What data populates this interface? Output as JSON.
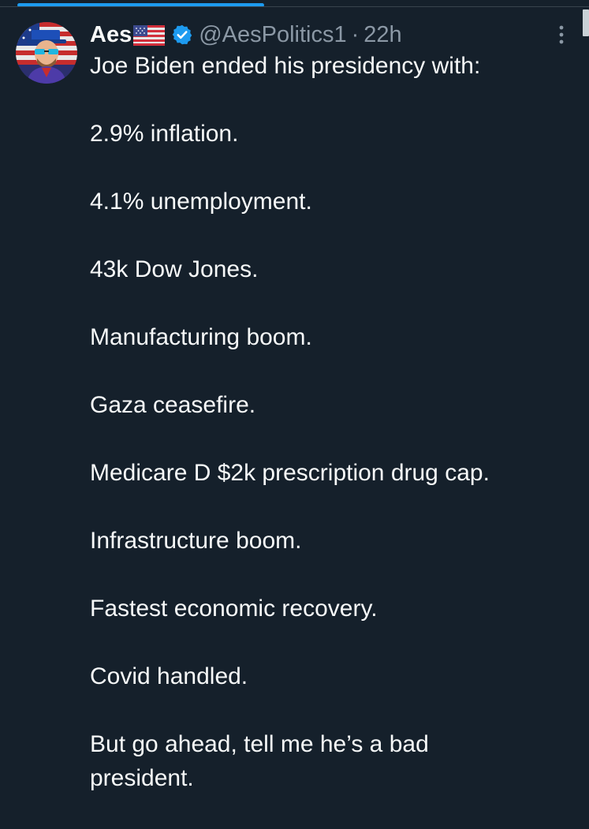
{
  "tweet": {
    "display_name": "Aes",
    "handle": "@AesPolitics1",
    "separator": "·",
    "time": "22h",
    "lines": [
      "Joe Biden ended his presidency with:",
      "2.9% inflation.",
      "4.1% unemployment.",
      "43k Dow Jones.",
      "Manufacturing boom.",
      "Gaza ceasefire.",
      "Medicare D $2k prescription drug cap.",
      "Infrastructure boom.",
      "Fastest economic recovery.",
      "Covid handled.",
      "But go ahead, tell me he’s a bad president."
    ]
  },
  "icons": {
    "flag": "us-flag-emoji",
    "verified": "verified-badge-icon",
    "more": "more-options-icon"
  },
  "colors": {
    "background": "#15202b",
    "text": "#f7f9f9",
    "muted": "#8b98a5",
    "accent": "#1d9bf0"
  }
}
